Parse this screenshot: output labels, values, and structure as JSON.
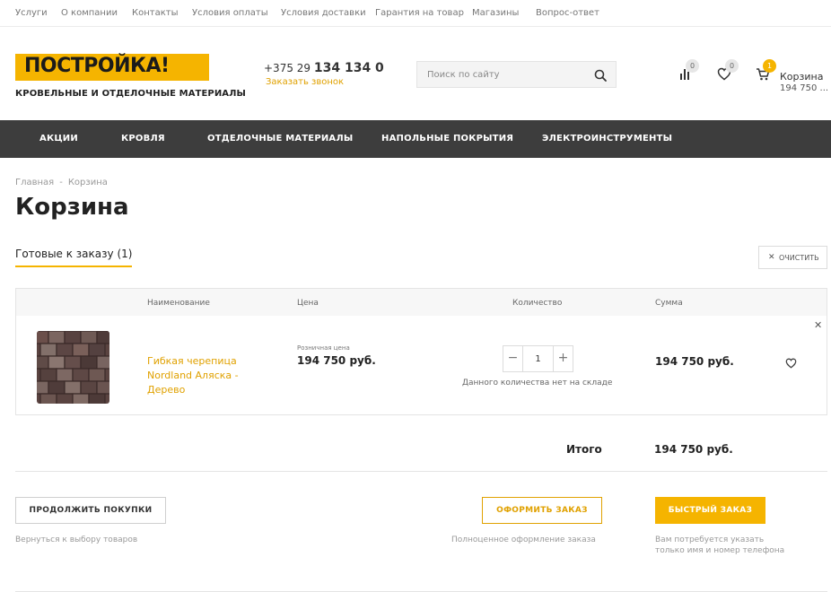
{
  "topbar": {
    "links": [
      "Услуги",
      "О компании",
      "Контакты",
      "Условия оплаты",
      "Условия доставки",
      "Гарантия на товар",
      "Магазины",
      "Вопрос-ответ"
    ]
  },
  "header": {
    "logo_text": "ПОСТРОЙКА!",
    "tagline": "КРОВЕЛЬНЫЕ И ОТДЕЛОЧНЫЕ МАТЕРИАЛЫ",
    "phone_prefix": "+375 29 ",
    "phone_main": "134 134 0",
    "callback": "Заказать звонок",
    "search_placeholder": "Поиск по сайту",
    "compare_count": "0",
    "favorites_count": "0",
    "cart_count": "1",
    "cart_label": "Корзина",
    "cart_sum": "194 750 ..."
  },
  "nav": {
    "items": [
      "АКЦИИ",
      "КРОВЛЯ",
      "ОТДЕЛОЧНЫЕ МАТЕРИАЛЫ",
      "НАПОЛЬНЫЕ ПОКРЫТИЯ",
      "ЭЛЕКТРОИНСТРУМЕНТЫ"
    ]
  },
  "breadcrumb": {
    "home": "Главная",
    "separator": "-",
    "current": "Корзина"
  },
  "page": {
    "title": "Корзина",
    "tab_ready": "Готовые к заказу",
    "tab_count": "(1)",
    "clear_label": "ОЧИСТИТЬ"
  },
  "table": {
    "headers": [
      "Наименование",
      "Цена",
      "Количество",
      "Сумма"
    ],
    "rows": [
      {
        "name": "Гибкая черепица Nordland Аляска - Дерево",
        "price_label": "Розничная цена",
        "price": "194 750 руб.",
        "quantity": "1",
        "stock_note": "Данного количества нет на складе",
        "sum": "194 750 руб."
      }
    ]
  },
  "totals": {
    "label": "Итого",
    "value": "194 750 руб."
  },
  "actions": {
    "continue_label": "ПРОДОЛЖИТЬ ПОКУПКИ",
    "continue_hint": "Вернуться к выбору товаров",
    "checkout_label": "ОФОРМИТЬ ЗАКАЗ",
    "checkout_hint": "Полноценное оформление заказа",
    "quick_label": "БЫСТРЫЙ ЗАКАЗ",
    "quick_hint_1": "Вам потребуется указать",
    "quick_hint_2": "только имя и номер телефона"
  },
  "colors": {
    "accent": "#f5b400",
    "accent_text": "#e0a100",
    "nav_bg": "#3d3d3d"
  },
  "icons": {
    "search": "search-icon",
    "compare": "bar-chart-icon",
    "favorites": "heart-icon",
    "cart": "cart-icon",
    "clear": "close-icon",
    "remove": "close-icon",
    "minus": "minus-icon",
    "plus": "plus-icon"
  }
}
